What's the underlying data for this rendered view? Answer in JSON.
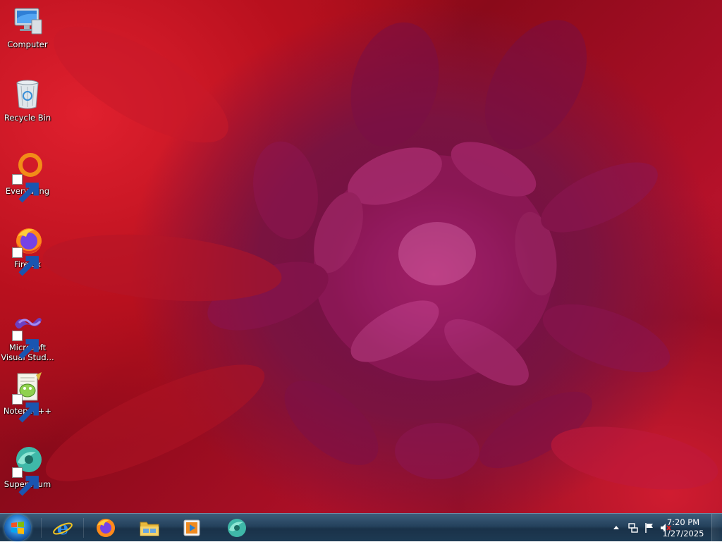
{
  "desktop": {
    "icons": [
      {
        "label": "Computer",
        "icon": "computer-icon"
      },
      {
        "label": "Recycle Bin",
        "icon": "recycle-bin-icon"
      },
      {
        "label": "Everything",
        "icon": "everything-icon"
      },
      {
        "label": "Firefox",
        "icon": "firefox-icon"
      },
      {
        "label": "Microsoft Visual Stud...",
        "icon": "visual-studio-icon"
      },
      {
        "label": "Notepad++",
        "icon": "notepad-plus-plus-icon"
      },
      {
        "label": "Supermium",
        "icon": "supermium-icon"
      }
    ]
  },
  "taskbar": {
    "start": {
      "icon": "windows-logo-icon"
    },
    "pinned": [
      {
        "name": "Internet Explorer",
        "icon": "internet-explorer-icon"
      },
      {
        "name": "Firefox",
        "icon": "firefox-icon"
      },
      {
        "name": "File Explorer",
        "icon": "folder-icon"
      },
      {
        "name": "Media Player",
        "icon": "media-player-icon"
      },
      {
        "name": "Supermium",
        "icon": "supermium-icon"
      }
    ],
    "tray": {
      "icons": [
        "show-hidden-icons-icon",
        "network-icon",
        "action-center-flag-icon",
        "volume-muted-icon"
      ],
      "time": "7:20 PM",
      "date": "1/27/2025"
    }
  },
  "colors": {
    "taskbar": "#1d3a53",
    "wallpaper_red": "#c8141e",
    "wallpaper_magenta": "#a8246e"
  }
}
